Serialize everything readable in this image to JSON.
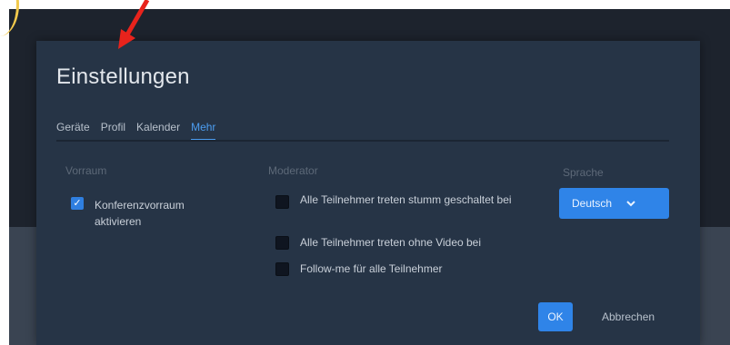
{
  "dialog": {
    "title": "Einstellungen",
    "tabs": [
      {
        "label": "Geräte",
        "active": false
      },
      {
        "label": "Profil",
        "active": false
      },
      {
        "label": "Kalender",
        "active": false
      },
      {
        "label": "Mehr",
        "active": true
      }
    ],
    "vorraum": {
      "heading": "Vorraum",
      "option": {
        "label": "Konferenzvorraum aktivieren",
        "checked": true
      }
    },
    "moderator": {
      "heading": "Moderator",
      "options": [
        {
          "label": "Alle Teilnehmer treten stumm geschaltet bei",
          "checked": false
        },
        {
          "label": "Alle Teilnehmer treten ohne Video bei",
          "checked": false
        },
        {
          "label": "Follow-me für alle Teilnehmer",
          "checked": false
        }
      ]
    },
    "sprache": {
      "heading": "Sprache",
      "selected": "Deutsch"
    },
    "buttons": {
      "ok": "OK",
      "cancel": "Abbrechen"
    }
  },
  "icons": {
    "chevron": "chevron-down-icon",
    "check": "checkmark-icon",
    "annotation": "red-arrow-icon"
  },
  "colors": {
    "accent": "#2f84e8",
    "dialog_bg": "#263446",
    "annotation_arrow": "#e8231c"
  }
}
